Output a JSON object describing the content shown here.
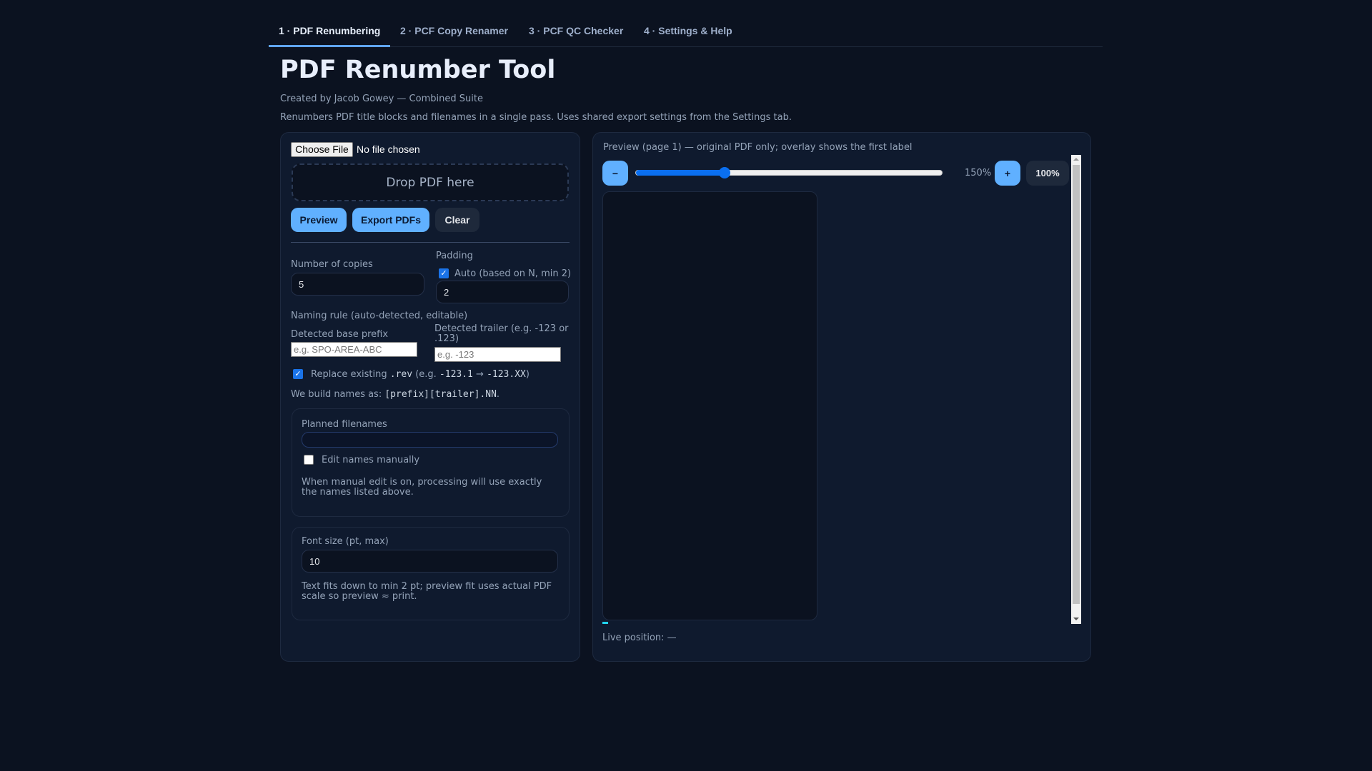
{
  "tabs": [
    "1 · PDF Renumbering",
    "2 · PCF Copy Renamer",
    "3 · PCF QC Checker",
    "4 · Settings & Help"
  ],
  "title": "PDF Renumber Tool",
  "credit": "Created by Jacob Gowey — Combined Suite",
  "description": "Renumbers PDF title blocks and filenames in a single pass. Uses shared export settings from the Settings tab.",
  "left": {
    "choose_file": "Choose File",
    "no_file": "No file chosen",
    "drop": "Drop PDF here",
    "preview": "Preview",
    "export": "Export PDFs",
    "clear": "Clear",
    "copies_label": "Number of copies",
    "copies_value": "5",
    "padding_label": "Padding",
    "padding_auto": "Auto (based on N, min 2)",
    "padding_auto_checked": true,
    "padding_value": "2",
    "naming_rule": "Naming rule (auto-detected, editable)",
    "prefix_label": "Detected base prefix",
    "prefix_placeholder": "e.g. SPO-AREA-ABC",
    "trailer_label": "Detected trailer (e.g. -123 or .123)",
    "trailer_placeholder": "e.g. -123",
    "replace_pre": "Replace existing ",
    "replace_code1": ".rev",
    "replace_mid": " (e.g. ",
    "replace_code2": "-123.1",
    "replace_arrow": " → ",
    "replace_code3": "-123.XX",
    "replace_end": ")",
    "replace_checked": true,
    "build_pre": "We build names as: ",
    "build_code": "[prefix][trailer].NN",
    "build_end": ".",
    "planned_label": "Planned filenames",
    "edit_manual": "Edit names manually",
    "edit_checked": false,
    "manual_note": "When manual edit is on, processing will use exactly the names listed above.",
    "font_label": "Font size (pt, max)",
    "font_value": "10",
    "font_note": "Text fits down to min 2 pt; preview fit uses actual PDF scale so preview ≈ print."
  },
  "right": {
    "caption": "Preview (page 1) — original PDF only; overlay shows the first label",
    "minus": "−",
    "plus": "+",
    "zoom_value": "150%",
    "zoom_slider_fraction": 0.29,
    "reset": "100%",
    "live": "Live position: —"
  }
}
